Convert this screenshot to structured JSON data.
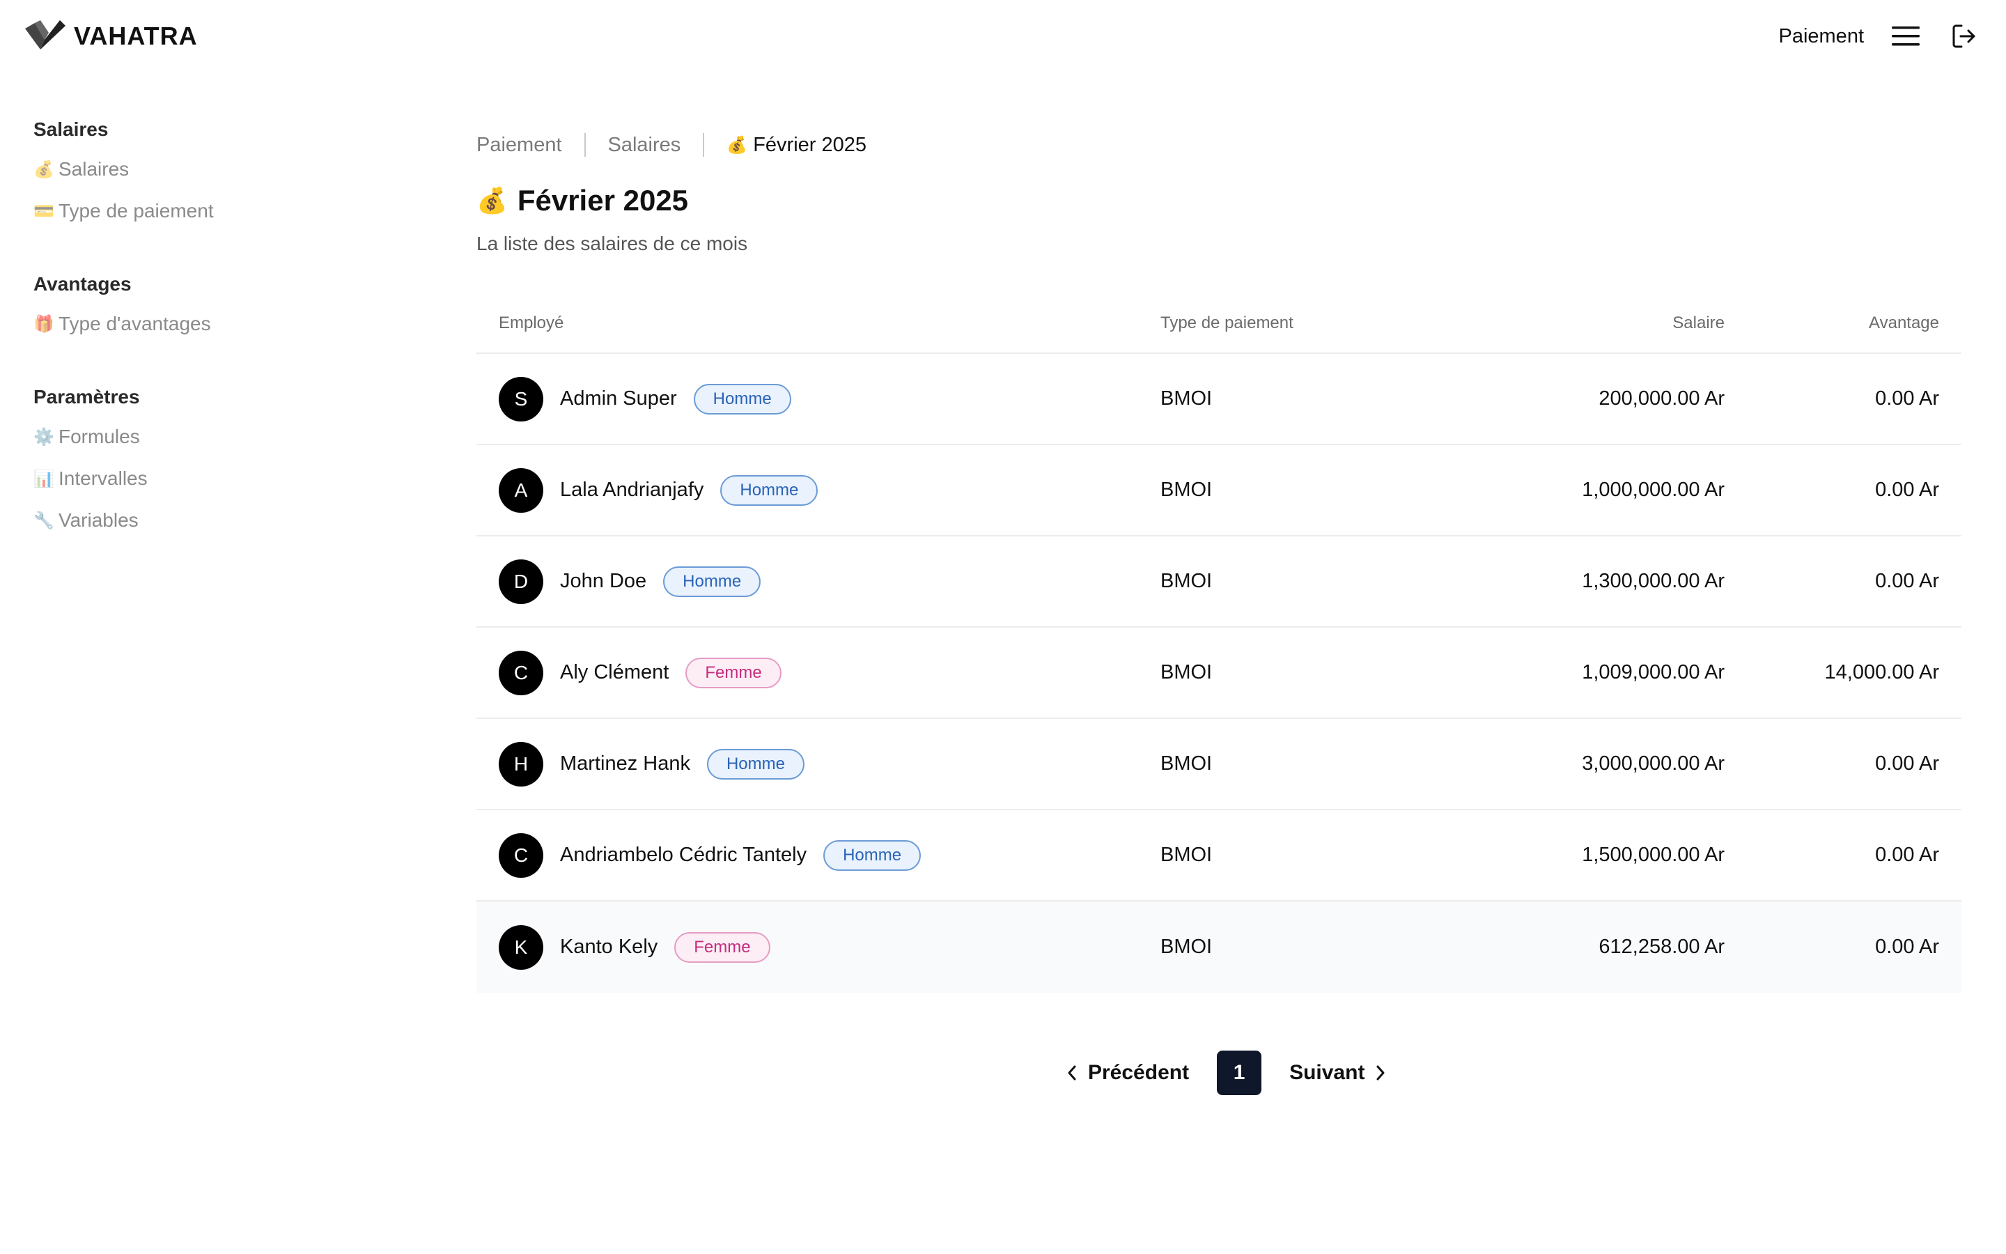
{
  "header": {
    "brand": "VAHATRA",
    "nav_link": "Paiement",
    "icons": {
      "logo": "vahatra-logo-icon",
      "menu": "hamburger-menu-icon",
      "logout": "logout-icon"
    }
  },
  "sidebar": {
    "groups": [
      {
        "heading": "Salaires",
        "items": [
          {
            "emoji": "💰",
            "label": "Salaires"
          },
          {
            "emoji": "💳",
            "label": "Type de paiement"
          }
        ]
      },
      {
        "heading": "Avantages",
        "items": [
          {
            "emoji": "🎁",
            "label": "Type d'avantages"
          }
        ]
      },
      {
        "heading": "Paramètres",
        "items": [
          {
            "emoji": "⚙️",
            "label": "Formules"
          },
          {
            "emoji": "📊",
            "label": "Intervalles"
          },
          {
            "emoji": "🔧",
            "label": "Variables"
          }
        ]
      }
    ]
  },
  "breadcrumb": [
    "Paiement",
    "Salaires",
    "Février 2025"
  ],
  "breadcrumb_emoji": "💰",
  "page": {
    "title_emoji": "💰",
    "title": "Février 2025",
    "subtitle": "La liste des salaires de ce mois"
  },
  "table": {
    "headers": {
      "employee": "Employé",
      "payment_type": "Type de paiement",
      "salary": "Salaire",
      "advantage": "Avantage"
    },
    "rows": [
      {
        "initial": "S",
        "name": "Admin Super",
        "gender": "Homme",
        "payment_type": "BMOI",
        "salary": "200,000.00 Ar",
        "advantage": "0.00 Ar"
      },
      {
        "initial": "A",
        "name": "Lala Andrianjafy",
        "gender": "Homme",
        "payment_type": "BMOI",
        "salary": "1,000,000.00 Ar",
        "advantage": "0.00 Ar"
      },
      {
        "initial": "D",
        "name": "John Doe",
        "gender": "Homme",
        "payment_type": "BMOI",
        "salary": "1,300,000.00 Ar",
        "advantage": "0.00 Ar"
      },
      {
        "initial": "C",
        "name": "Aly Clément",
        "gender": "Femme",
        "payment_type": "BMOI",
        "salary": "1,009,000.00 Ar",
        "advantage": "14,000.00 Ar"
      },
      {
        "initial": "H",
        "name": "Martinez Hank",
        "gender": "Homme",
        "payment_type": "BMOI",
        "salary": "3,000,000.00 Ar",
        "advantage": "0.00 Ar"
      },
      {
        "initial": "C",
        "name": "Andriambelo Cédric Tantely",
        "gender": "Homme",
        "payment_type": "BMOI",
        "salary": "1,500,000.00 Ar",
        "advantage": "0.00 Ar"
      },
      {
        "initial": "K",
        "name": "Kanto Kely",
        "gender": "Femme",
        "payment_type": "BMOI",
        "salary": "612,258.00 Ar",
        "advantage": "0.00 Ar"
      }
    ]
  },
  "pagination": {
    "prev": "Précédent",
    "current_page": "1",
    "next": "Suivant"
  },
  "colors": {
    "dark": "#0f172a",
    "homme": "#2a63b8",
    "femme": "#c42d7d",
    "muted": "#8a8a8a"
  }
}
